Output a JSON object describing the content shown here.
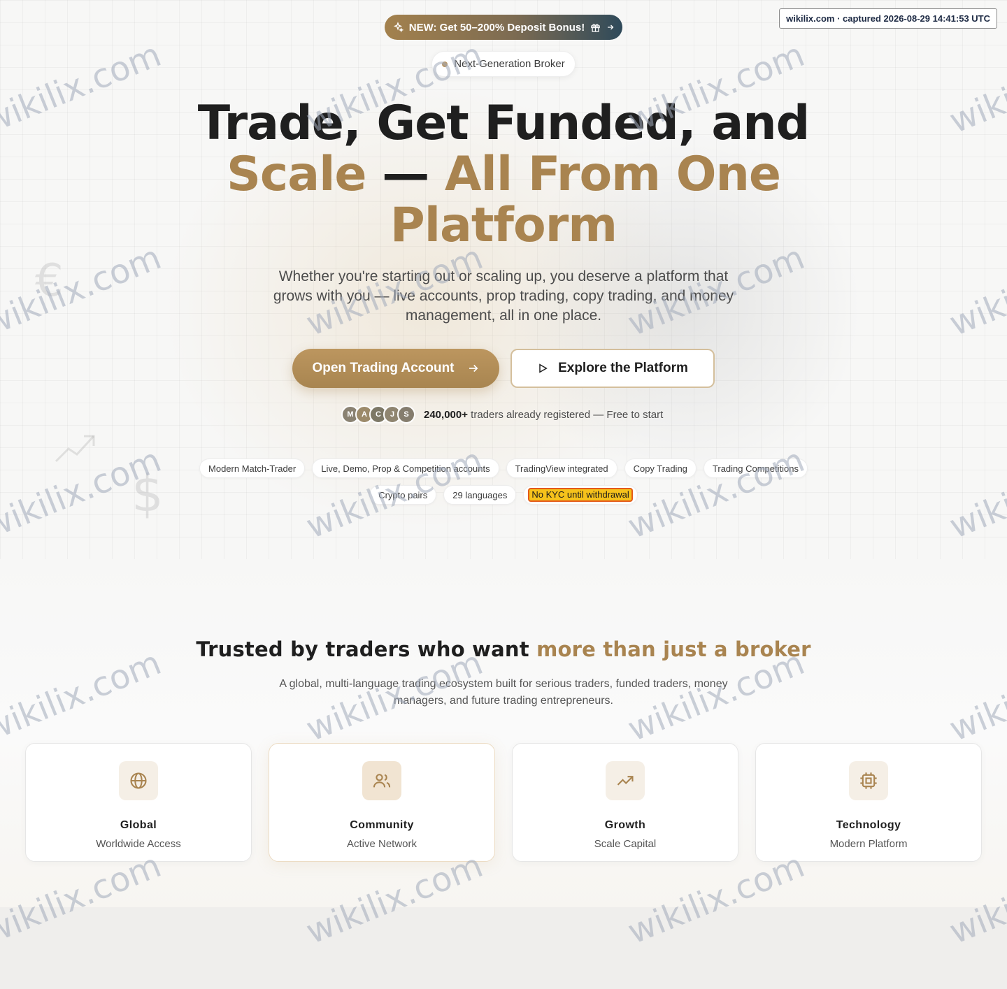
{
  "capture_stamp": "wikilix.com · captured 2026-08-29 14:41:53 UTC",
  "watermark_text": "wikilix.com",
  "promo": {
    "label": "NEW: Get 50–200% Deposit Bonus!",
    "lead_icon": "sparkles-icon",
    "gift_icon": "gift-icon",
    "arrow_icon": "arrow-right-icon"
  },
  "badge": {
    "label": "Next-Generation Broker"
  },
  "hero": {
    "title_line1": "Trade, Get Funded, and",
    "title_line2_gold_a": "Scale",
    "title_line2_dash": " — ",
    "title_line2_gold_b": "All From One",
    "title_line3_gold": "Platform",
    "subtitle": "Whether you're starting out or scaling up, you deserve a platform that grows with you — live accounts, prop trading, copy trading, and money management, all in one place.",
    "primary_cta": "Open Trading Account",
    "secondary_cta": "Explore the Platform"
  },
  "social_proof": {
    "avatars": [
      {
        "initial": "M",
        "color": "#8a8272"
      },
      {
        "initial": "A",
        "color": "#9c8a6a"
      },
      {
        "initial": "C",
        "color": "#7d7866"
      },
      {
        "initial": "J",
        "color": "#8f8570"
      },
      {
        "initial": "S",
        "color": "#857d6e"
      }
    ],
    "count": "240,000+",
    "text": " traders already registered — Free to start"
  },
  "features_row1": [
    "Modern Match-Trader",
    "Live, Demo, Prop & Competition accounts",
    "TradingView integrated",
    "Copy Trading",
    "Trading Competitions"
  ],
  "features_row2": [
    "Crypto pairs",
    "29 languages"
  ],
  "highlight_chip": "No KYC until withdrawal",
  "trust": {
    "title_plain": "Trusted by traders who want ",
    "title_gold": "more than just a broker",
    "subtitle": "A global, multi-language trading ecosystem built for serious traders, funded traders, money managers, and future trading entrepreneurs."
  },
  "cards": [
    {
      "icon": "globe-icon",
      "title": "Global",
      "subtitle": "Worldwide Access"
    },
    {
      "icon": "users-icon",
      "title": "Community",
      "subtitle": "Active Network"
    },
    {
      "icon": "trending-up-icon",
      "title": "Growth",
      "subtitle": "Scale Capital"
    },
    {
      "icon": "cpu-chip-icon",
      "title": "Technology",
      "subtitle": "Modern Platform"
    }
  ],
  "colors": {
    "gold": "#a98450",
    "gold_button": "#b38f5a",
    "dark_teal": "#2f4a5a",
    "highlight_yellow": "#f6c21b",
    "highlight_border": "#e35b1b"
  }
}
